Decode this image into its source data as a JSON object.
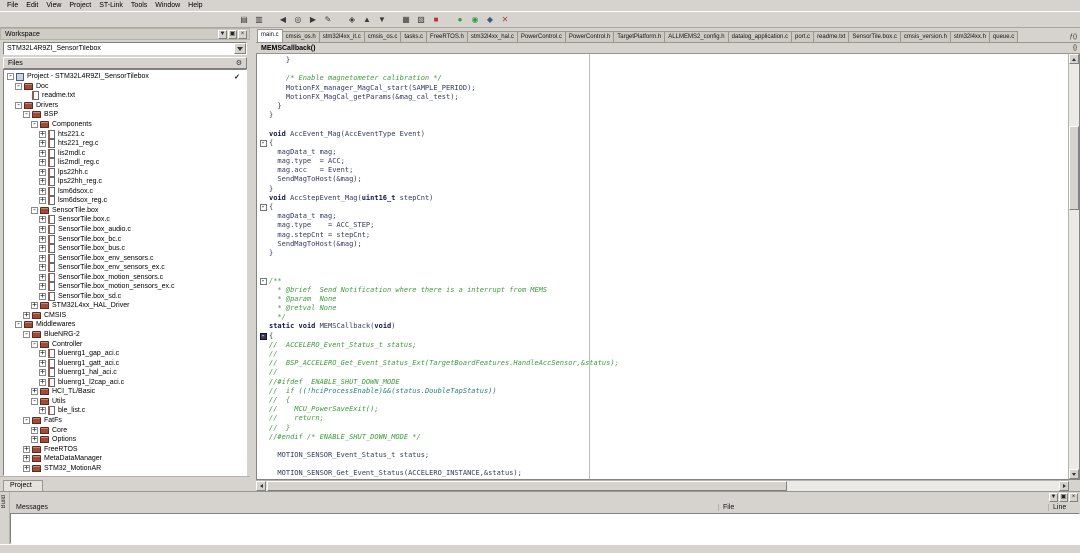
{
  "colors": {
    "plain": "#333a63",
    "comment": "#3f9b3f",
    "keyword": "#141452",
    "teal": "#2a7f7f",
    "green": "#2e9e40"
  },
  "menu": {
    "items": [
      "File",
      "Edit",
      "View",
      "Project",
      "ST-Link",
      "Tools",
      "Window",
      "Help"
    ]
  },
  "toolbar": {
    "icons": [
      {
        "name": "open-file-icon",
        "glyph": "▤"
      },
      {
        "name": "save-all-icon",
        "glyph": "▥"
      },
      {
        "name": "nav-back-icon",
        "glyph": "◀",
        "gap": true
      },
      {
        "name": "find-icon",
        "glyph": "◎"
      },
      {
        "name": "nav-forward-icon",
        "glyph": "▶"
      },
      {
        "name": "edit-icon",
        "glyph": "✎"
      },
      {
        "name": "toggle-bookmark-icon",
        "glyph": "◈",
        "gap": true
      },
      {
        "name": "prev-bookmark-icon",
        "glyph": "▲"
      },
      {
        "name": "next-bookmark-icon",
        "glyph": "▼"
      },
      {
        "name": "make-icon",
        "glyph": "▦",
        "gap": true
      },
      {
        "name": "compile-icon",
        "glyph": "▧"
      },
      {
        "name": "stop-build-icon",
        "glyph": "■",
        "color": "#b03a2e"
      },
      {
        "name": "download-and-debug-icon",
        "glyph": "●",
        "color": "#2e9e40",
        "gap": true
      },
      {
        "name": "debug-without-downloading-icon",
        "glyph": "◉",
        "color": "#2e9e40"
      },
      {
        "name": "cpu-reset-icon",
        "glyph": "◆",
        "color": "#3a5a8c"
      },
      {
        "name": "stop-debug-icon",
        "glyph": "✕",
        "color": "#b03a2e"
      }
    ]
  },
  "panel_buttons": [
    {
      "name": "window-menu-icon",
      "glyph": "▼"
    },
    {
      "name": "dock-window-icon",
      "glyph": "▣"
    },
    {
      "name": "close-window-icon",
      "glyph": "×"
    }
  ],
  "workspace": {
    "caption": "Workspace",
    "combo_value": "STM32L4R9ZI_SensorTilebox",
    "files_header": "Files",
    "gear_glyph": "⚙",
    "check_glyph": "✓",
    "project_tab": "Project",
    "twisty_glyphs": {
      "open": "-",
      "closed": "+"
    },
    "tree": [
      {
        "depth": 0,
        "icon": "project",
        "twisty": "open",
        "label": "Project - STM32L4R9ZI_SensorTilebox",
        "check": true
      },
      {
        "depth": 1,
        "icon": "folder",
        "twisty": "open",
        "label": "Doc"
      },
      {
        "depth": 2,
        "icon": "file",
        "twisty": "none",
        "label": "readme.txt"
      },
      {
        "depth": 1,
        "icon": "folder",
        "twisty": "open",
        "label": "Drivers"
      },
      {
        "depth": 2,
        "icon": "folder",
        "twisty": "open",
        "label": "BSP"
      },
      {
        "depth": 3,
        "icon": "folder",
        "twisty": "open",
        "label": "Components"
      },
      {
        "depth": 4,
        "icon": "file",
        "twisty": "closed",
        "label": "hts221.c"
      },
      {
        "depth": 4,
        "icon": "file",
        "twisty": "closed",
        "label": "hts221_reg.c"
      },
      {
        "depth": 4,
        "icon": "file",
        "twisty": "closed",
        "label": "lis2mdl.c"
      },
      {
        "depth": 4,
        "icon": "file",
        "twisty": "closed",
        "label": "lis2mdl_reg.c"
      },
      {
        "depth": 4,
        "icon": "file",
        "twisty": "closed",
        "label": "lps22hh.c"
      },
      {
        "depth": 4,
        "icon": "file",
        "twisty": "closed",
        "label": "lps22hh_reg.c"
      },
      {
        "depth": 4,
        "icon": "file",
        "twisty": "closed",
        "label": "lsm6dsox.c"
      },
      {
        "depth": 4,
        "icon": "file",
        "twisty": "closed",
        "label": "lsm6dsox_reg.c"
      },
      {
        "depth": 3,
        "icon": "folder",
        "twisty": "open",
        "label": "SensorTile.box"
      },
      {
        "depth": 4,
        "icon": "file",
        "twisty": "closed",
        "label": "SensorTile.box.c"
      },
      {
        "depth": 4,
        "icon": "file",
        "twisty": "closed",
        "label": "SensorTile.box_audio.c"
      },
      {
        "depth": 4,
        "icon": "file",
        "twisty": "closed",
        "label": "SensorTile.box_bc.c"
      },
      {
        "depth": 4,
        "icon": "file",
        "twisty": "closed",
        "label": "SensorTile.box_bus.c"
      },
      {
        "depth": 4,
        "icon": "file",
        "twisty": "closed",
        "label": "SensorTile.box_env_sensors.c"
      },
      {
        "depth": 4,
        "icon": "file",
        "twisty": "closed",
        "label": "SensorTile.box_env_sensors_ex.c"
      },
      {
        "depth": 4,
        "icon": "file",
        "twisty": "closed",
        "label": "SensorTile.box_motion_sensors.c"
      },
      {
        "depth": 4,
        "icon": "file",
        "twisty": "closed",
        "label": "SensorTile.box_motion_sensors_ex.c"
      },
      {
        "depth": 4,
        "icon": "file",
        "twisty": "closed",
        "label": "SensorTile.box_sd.c"
      },
      {
        "depth": 3,
        "icon": "folder",
        "twisty": "closed",
        "label": "STM32L4xx_HAL_Driver"
      },
      {
        "depth": 2,
        "icon": "folder",
        "twisty": "closed",
        "label": "CMSIS"
      },
      {
        "depth": 1,
        "icon": "folder",
        "twisty": "open",
        "label": "Middlewares"
      },
      {
        "depth": 2,
        "icon": "folder",
        "twisty": "open",
        "label": "BlueNRG-2"
      },
      {
        "depth": 3,
        "icon": "folder",
        "twisty": "open",
        "label": "Controller"
      },
      {
        "depth": 4,
        "icon": "file",
        "twisty": "closed",
        "label": "bluenrg1_gap_aci.c"
      },
      {
        "depth": 4,
        "icon": "file",
        "twisty": "closed",
        "label": "bluenrg1_gatt_aci.c"
      },
      {
        "depth": 4,
        "icon": "file",
        "twisty": "closed",
        "label": "bluenrg1_hal_aci.c"
      },
      {
        "depth": 4,
        "icon": "file",
        "twisty": "closed",
        "label": "bluenrg1_l2cap_aci.c"
      },
      {
        "depth": 3,
        "icon": "folder",
        "twisty": "closed",
        "label": "HCI_TL/Basic"
      },
      {
        "depth": 3,
        "icon": "folder",
        "twisty": "open",
        "label": "Utils"
      },
      {
        "depth": 4,
        "icon": "file",
        "twisty": "closed",
        "label": "ble_list.c"
      },
      {
        "depth": 2,
        "icon": "folder",
        "twisty": "open",
        "label": "FatFs"
      },
      {
        "depth": 3,
        "icon": "folder",
        "twisty": "closed",
        "label": "Core"
      },
      {
        "depth": 3,
        "icon": "folder",
        "twisty": "closed",
        "label": "Options"
      },
      {
        "depth": 2,
        "icon": "folder",
        "twisty": "closed",
        "label": "FreeRTOS"
      },
      {
        "depth": 2,
        "icon": "folder",
        "twisty": "closed",
        "label": "MetaDataManager"
      },
      {
        "depth": 2,
        "icon": "folder",
        "twisty": "closed",
        "label": "STM32_MotionAR"
      }
    ]
  },
  "editor": {
    "fn_glyph": "ƒ()",
    "symbols_glyph": "{}",
    "function_selector": "MEMSCallback()",
    "tabs": [
      {
        "label": "main.c",
        "active": true
      },
      {
        "label": "cmsis_os.h"
      },
      {
        "label": "stm32l4xx_it.c"
      },
      {
        "label": "cmsis_os.c"
      },
      {
        "label": "tasks.c"
      },
      {
        "label": "FreeRTOS.h"
      },
      {
        "label": "stm32l4xx_hal.c"
      },
      {
        "label": "PowerControl.c"
      },
      {
        "label": "PowerControl.h"
      },
      {
        "label": "TargetPlatform.h"
      },
      {
        "label": "ALLMEMS2_config.h"
      },
      {
        "label": "datalog_application.c"
      },
      {
        "label": "port.c"
      },
      {
        "label": "readme.txt"
      },
      {
        "label": "SensorTile.box.c"
      },
      {
        "label": "cmsis_version.h"
      },
      {
        "label": "stm32l4xx.h"
      },
      {
        "label": "queue.c"
      }
    ],
    "code": {
      "fold_glyph": "-",
      "lines": [
        {
          "seg": [
            [
              "    }",
              "p"
            ]
          ]
        },
        {
          "seg": []
        },
        {
          "seg": [
            [
              "    ",
              "p"
            ],
            [
              "/* Enable magnetometer calibration */",
              "c"
            ]
          ]
        },
        {
          "seg": [
            [
              "    MotionFX_manager_MagCal_start(SAMPLE_PERIOD);",
              "p"
            ]
          ]
        },
        {
          "seg": [
            [
              "    MotionFX_MagCal_getParams(&mag_cal_test);",
              "p"
            ]
          ]
        },
        {
          "seg": [
            [
              "  }",
              "p"
            ]
          ]
        },
        {
          "seg": [
            [
              "}",
              "p"
            ]
          ]
        },
        {
          "seg": []
        },
        {
          "seg": [
            [
              "void",
              "k"
            ],
            [
              " AccEvent_Mag(AccEventType Event)",
              "p"
            ]
          ]
        },
        {
          "fold": "open",
          "seg": [
            [
              "{",
              "p"
            ]
          ]
        },
        {
          "seg": [
            [
              "  magData_t mag;",
              "p"
            ]
          ]
        },
        {
          "seg": [
            [
              "  mag.type  = ACC;",
              "p"
            ]
          ]
        },
        {
          "seg": [
            [
              "  mag.acc   = Event;",
              "p"
            ]
          ]
        },
        {
          "seg": [
            [
              "  SendMagToHost(&mag);",
              "p"
            ]
          ]
        },
        {
          "seg": [
            [
              "}",
              "p"
            ]
          ]
        },
        {
          "seg": [
            [
              "void",
              "k"
            ],
            [
              " AccStepEvent_Mag(",
              "p"
            ],
            [
              "uint16_t",
              "k"
            ],
            [
              " stepCnt)",
              "p"
            ]
          ]
        },
        {
          "fold": "open",
          "seg": [
            [
              "{",
              "p"
            ]
          ]
        },
        {
          "seg": [
            [
              "  magData_t mag;",
              "p"
            ]
          ]
        },
        {
          "seg": [
            [
              "  mag.type    = ACC_STEP;",
              "p"
            ]
          ]
        },
        {
          "seg": [
            [
              "  mag.stepCnt = stepCnt;",
              "p"
            ]
          ]
        },
        {
          "seg": [
            [
              "  SendMagToHost(&mag);",
              "p"
            ]
          ]
        },
        {
          "seg": [
            [
              "}",
              "p"
            ]
          ]
        },
        {
          "seg": []
        },
        {
          "seg": []
        },
        {
          "fold": "open",
          "seg": [
            [
              "/**",
              "c"
            ]
          ]
        },
        {
          "seg": [
            [
              "  * @brief  Send Notification where there is a interrupt from MEMS",
              "c"
            ]
          ]
        },
        {
          "seg": [
            [
              "  * @param  None",
              "c"
            ]
          ]
        },
        {
          "seg": [
            [
              "  * @retval None",
              "c"
            ]
          ]
        },
        {
          "seg": [
            [
              "  */",
              "c"
            ]
          ]
        },
        {
          "seg": [
            [
              "static",
              "k"
            ],
            [
              " ",
              "p"
            ],
            [
              "void",
              "k"
            ],
            [
              " MEMSCallback(",
              "p"
            ],
            [
              "void",
              "k"
            ],
            [
              ")",
              "p"
            ]
          ]
        },
        {
          "fold": "current",
          "seg": [
            [
              "{",
              "p"
            ]
          ]
        },
        {
          "seg": [
            [
              "//  ACCELERO_Event_Status_t status;",
              "c"
            ]
          ]
        },
        {
          "seg": [
            [
              "//",
              "c"
            ]
          ]
        },
        {
          "seg": [
            [
              "//  BSP_ACCELERO_Get_Event_Status_Ext(TargetBoardFeatures.HandleAccSensor,&status);",
              "c"
            ]
          ]
        },
        {
          "seg": [
            [
              "//",
              "c"
            ]
          ]
        },
        {
          "seg": [
            [
              "//#ifdef  ENABLE_SHUT_DOWN_MODE",
              "c"
            ]
          ]
        },
        {
          "seg": [
            [
              "//  if ",
              "c"
            ],
            [
              "((!hciProcessEnable)&&(status.DoubleTapStatus))",
              "t"
            ]
          ]
        },
        {
          "seg": [
            [
              "//  {",
              "c"
            ]
          ]
        },
        {
          "seg": [
            [
              "//    MCU_PowerSaveExit();",
              "c"
            ]
          ]
        },
        {
          "seg": [
            [
              "//    return;",
              "c"
            ]
          ]
        },
        {
          "seg": [
            [
              "//  }",
              "c"
            ]
          ]
        },
        {
          "seg": [
            [
              "//#endif /* ENABLE_SHUT_DOWN_MODE */",
              "c"
            ]
          ]
        },
        {
          "seg": []
        },
        {
          "seg": [
            [
              "  MOTION_SENSOR_Event_Status_t status;",
              "p"
            ]
          ]
        },
        {
          "seg": []
        },
        {
          "seg": [
            [
              "  MOTION_SENSOR_Get_Event_Status(ACCELERO_INSTANCE,&status);",
              "p"
            ]
          ]
        }
      ]
    }
  },
  "build": {
    "caption": "Build",
    "columns": [
      "Messages",
      "File",
      "Line"
    ]
  }
}
